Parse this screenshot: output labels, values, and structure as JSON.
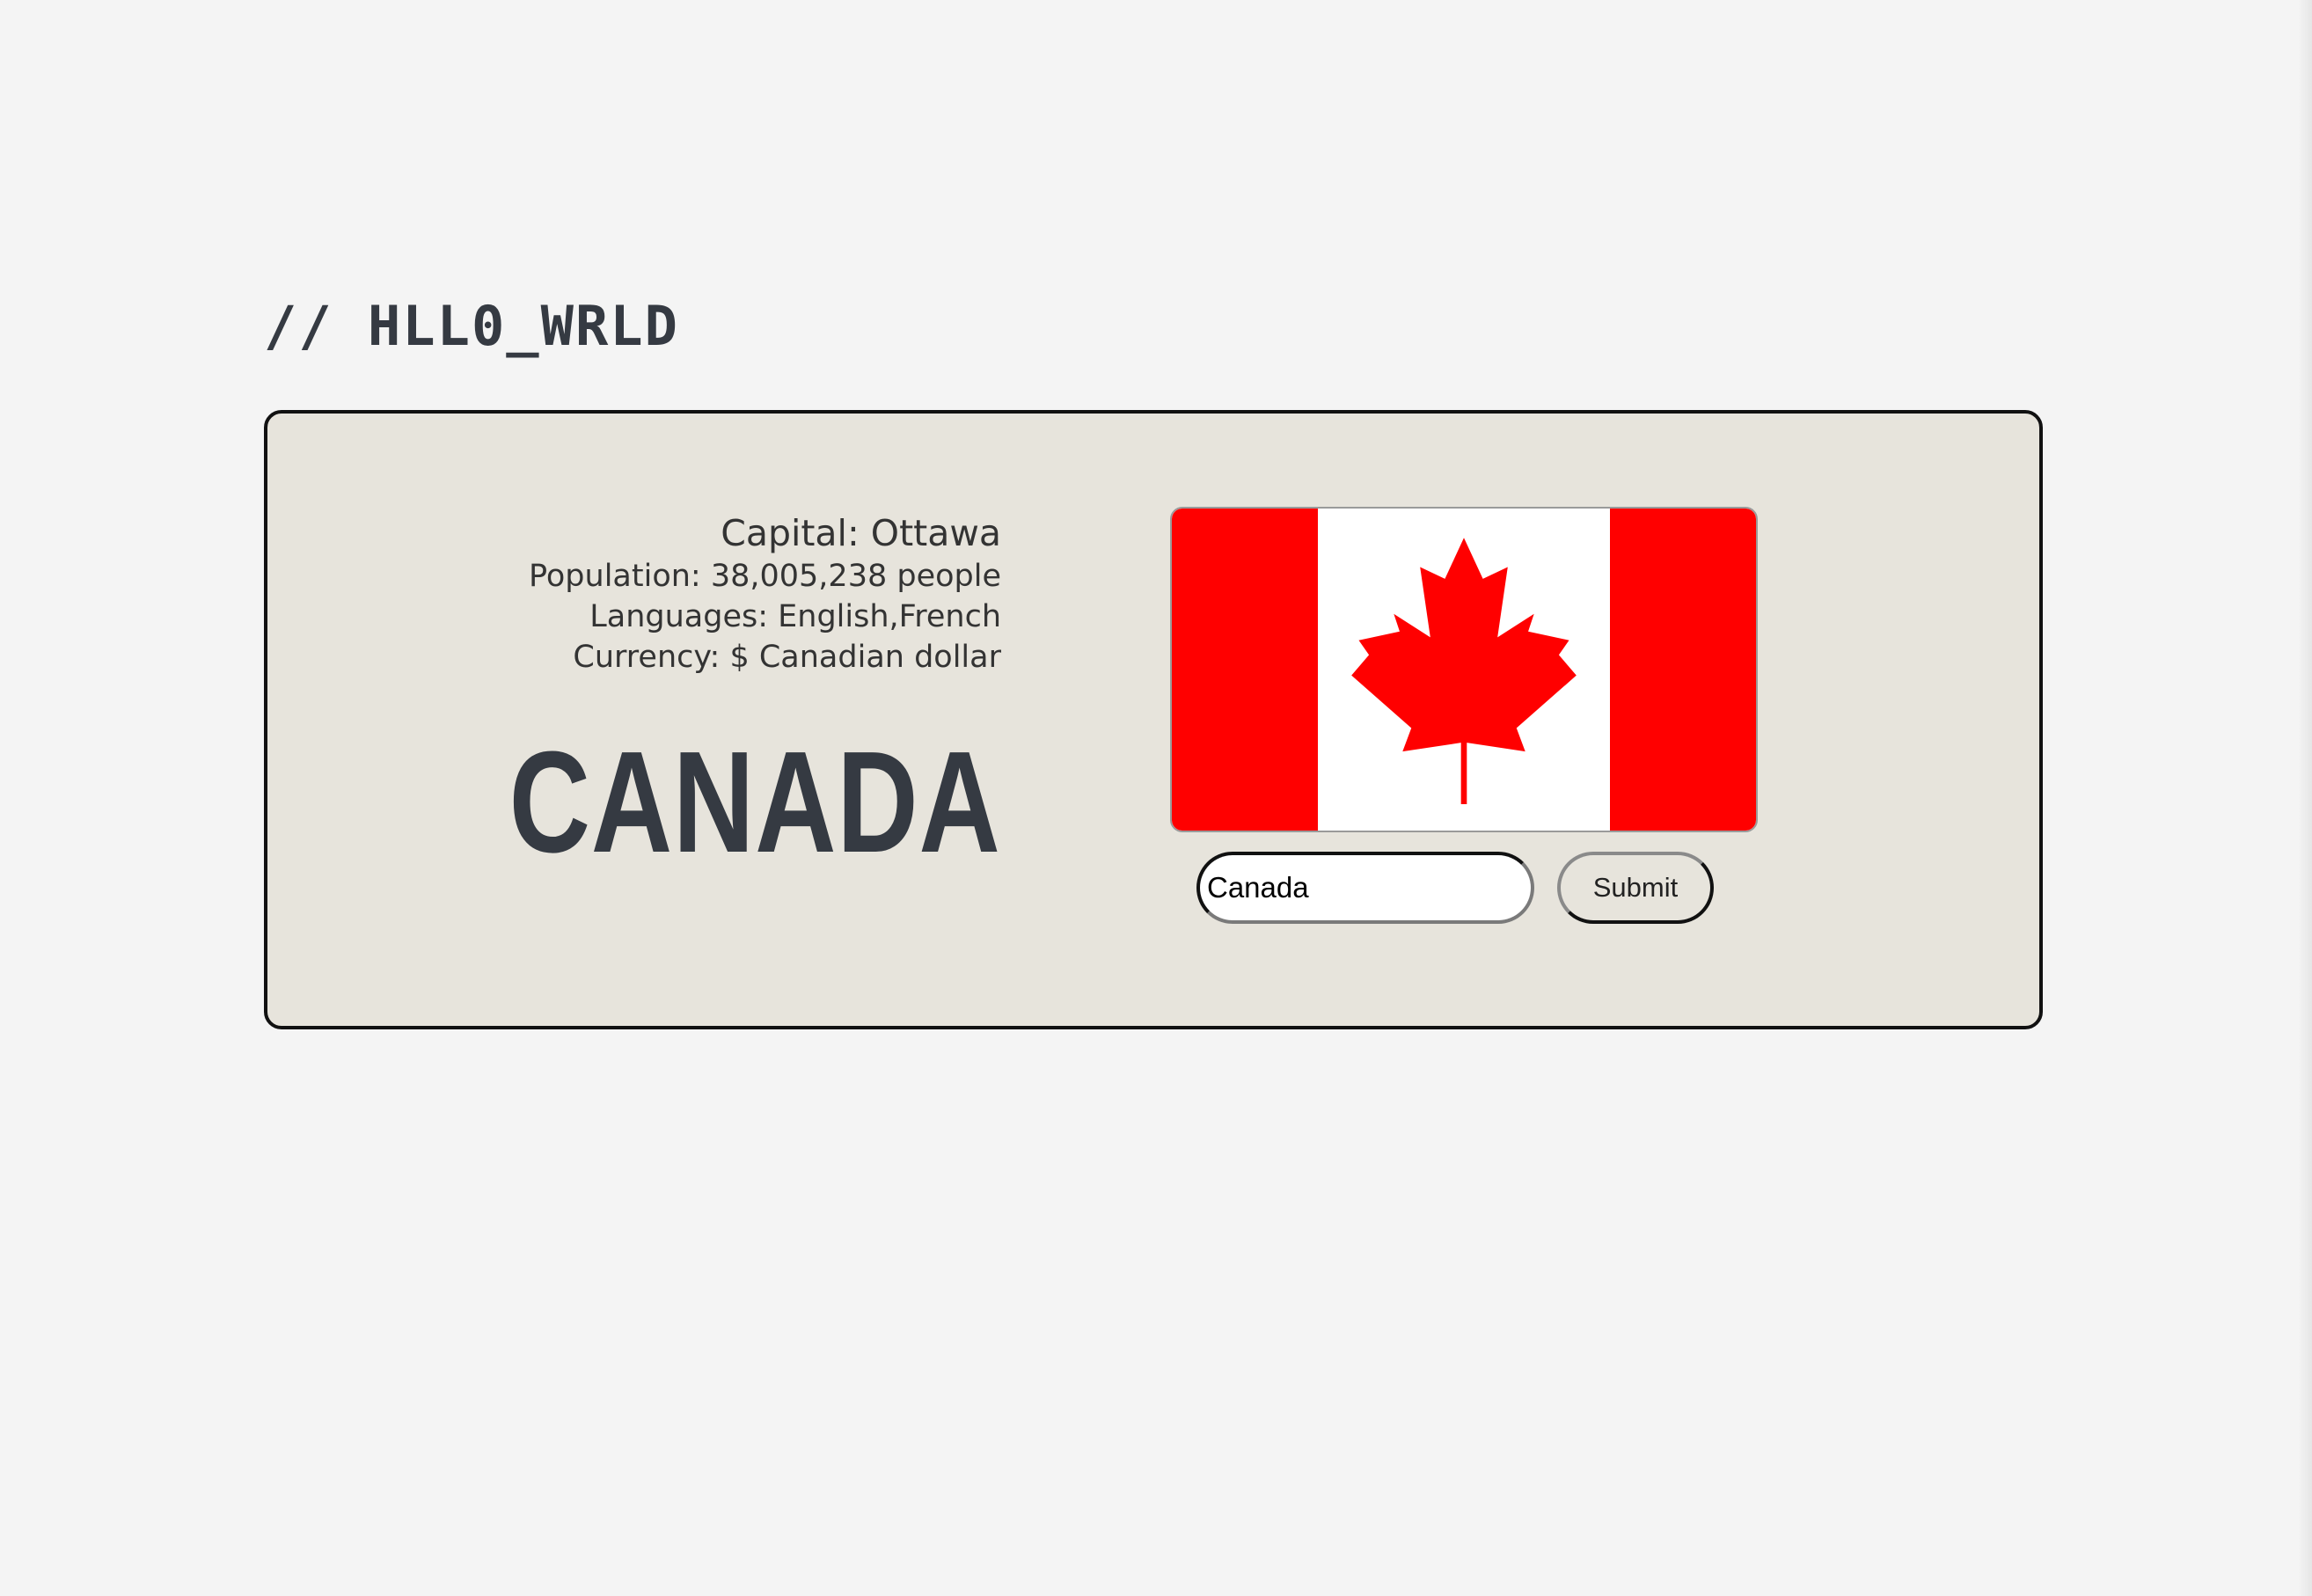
{
  "header": {
    "title": "// HLL0_WRLD"
  },
  "country": {
    "capital": "Capital: Ottawa",
    "population": "Population: 38,005,238 people",
    "languages": "Languages: English,French",
    "currency": "Currency: $ Canadian dollar",
    "name": "CANADA"
  },
  "flag": {
    "icon": "canada-flag-icon",
    "colors": {
      "red": "#ff0000",
      "white": "#ffffff"
    }
  },
  "search": {
    "value": "Canada",
    "placeholder": ""
  },
  "actions": {
    "submit_label": "Submit"
  },
  "colors": {
    "page_background": "#f4f4f4",
    "card_background": "#e7e4dc",
    "text_dark": "#353a42",
    "border": "#111111"
  }
}
